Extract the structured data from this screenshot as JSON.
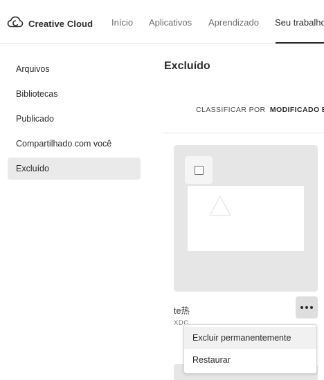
{
  "app": {
    "brand_name": "Creative Cloud",
    "brand_icon": "creative-cloud-logo"
  },
  "nav": {
    "tabs": [
      {
        "label": "Início"
      },
      {
        "label": "Aplicativos"
      },
      {
        "label": "Aprendizado"
      },
      {
        "label": "Seu trabalho"
      }
    ],
    "active_tab": "Seu trabalho"
  },
  "sidebar": {
    "items": [
      {
        "label": "Arquivos"
      },
      {
        "label": "Bibliotecas"
      },
      {
        "label": "Publicado"
      },
      {
        "label": "Compartilhado com você"
      },
      {
        "label": "Excluído"
      }
    ],
    "selected": "Excluído"
  },
  "main": {
    "title": "Excluído",
    "sort": {
      "label": "CLASSIFICAR POR",
      "value": "MODIFICADO EM"
    },
    "files": [
      {
        "name": "te热",
        "type": "XDC",
        "thumbnail_icon": "triangle-icon"
      }
    ]
  },
  "context_menu": {
    "items": [
      {
        "label": "Excluir permanentemente"
      },
      {
        "label": "Restaurar"
      }
    ],
    "highlighted": "Excluir permanentemente"
  },
  "colors": {
    "text": "#2c2c2c",
    "muted": "#6e6e6e",
    "card_bg": "#e6e6e6",
    "selected_bg": "#eaeaea"
  }
}
